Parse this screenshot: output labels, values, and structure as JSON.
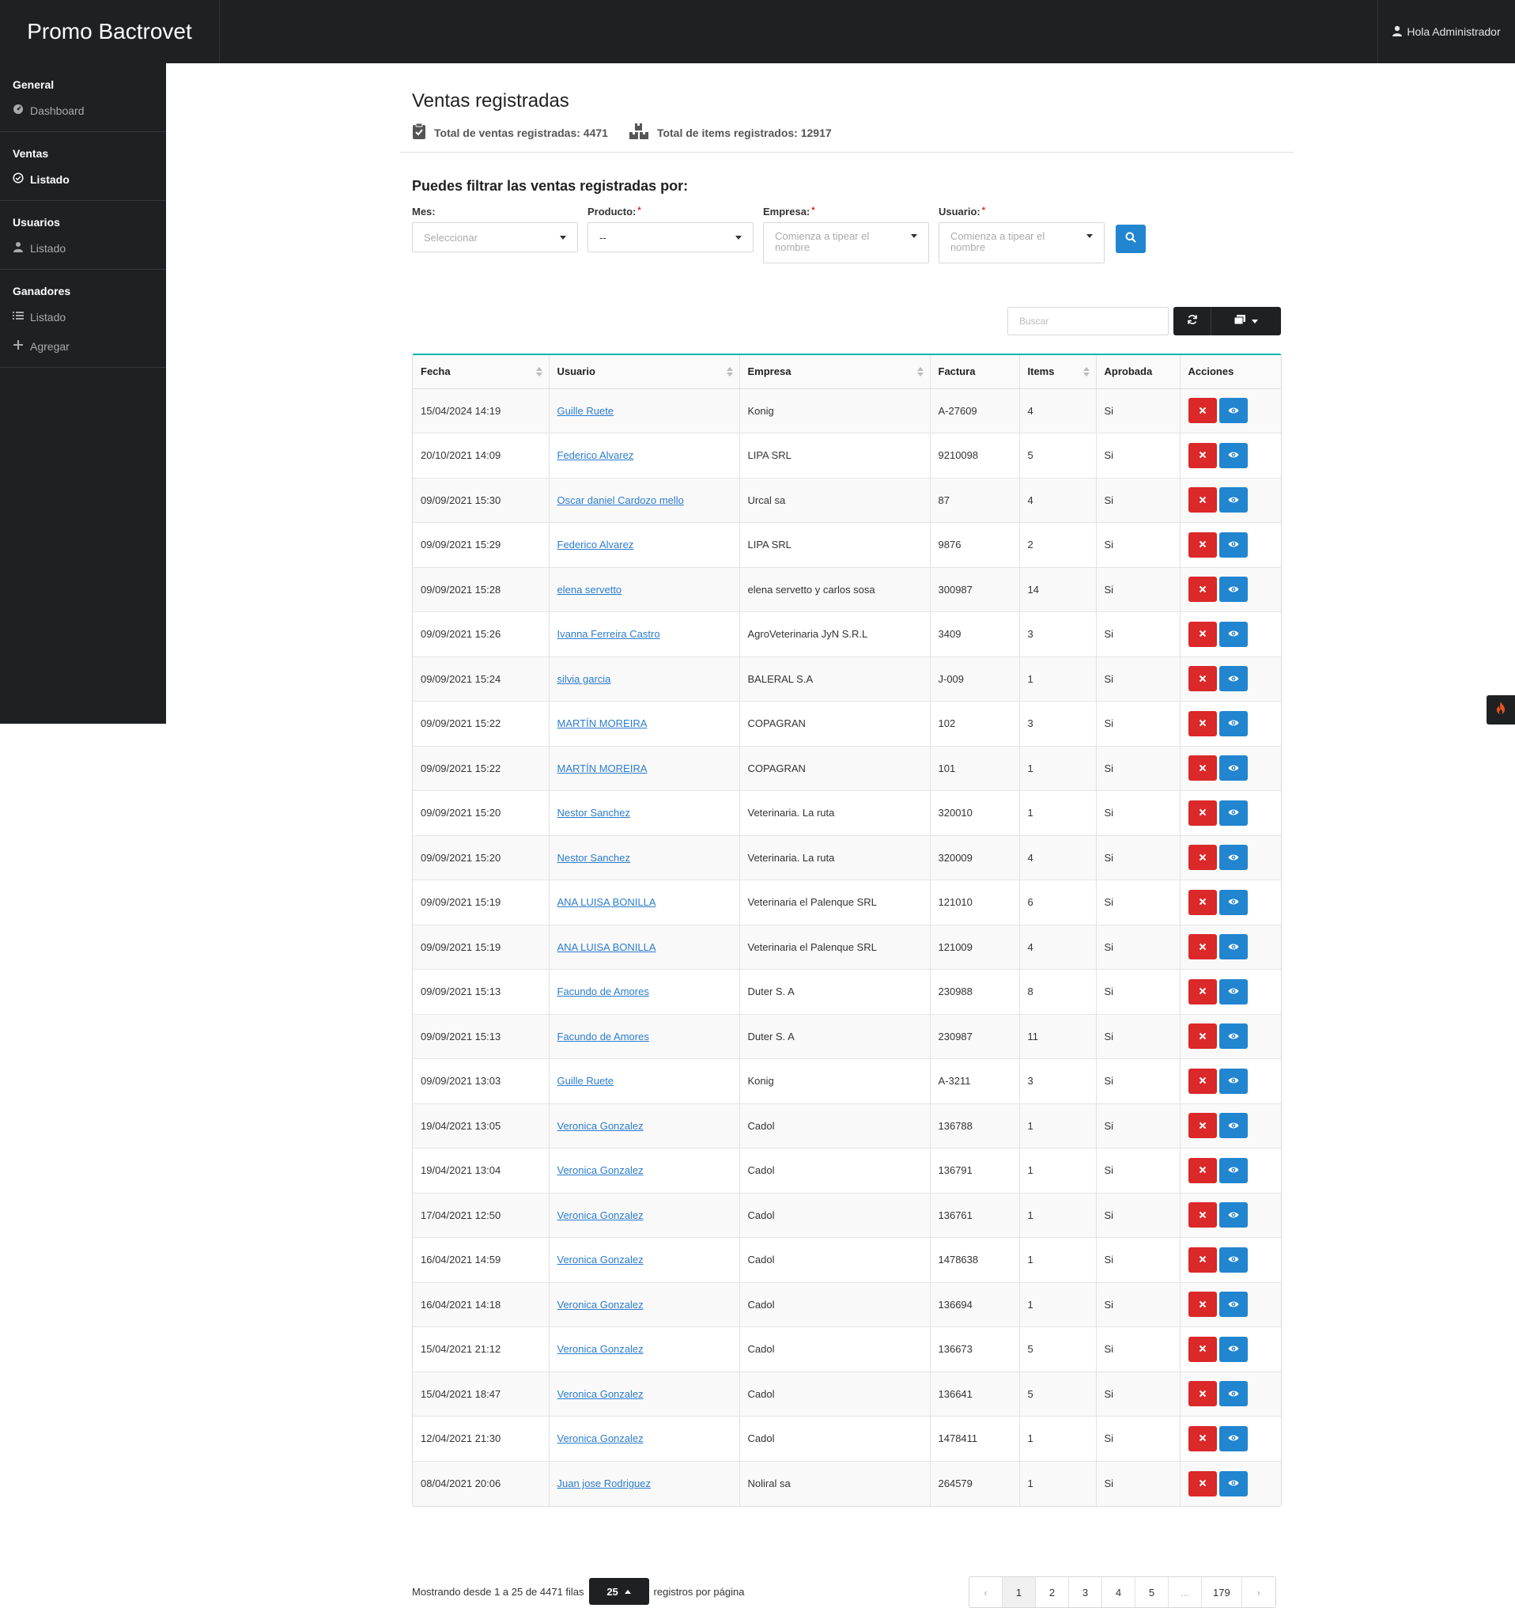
{
  "app": {
    "brand": "Promo Bactrovet",
    "user_greeting": "Hola Administrador"
  },
  "sidebar": {
    "sections": [
      {
        "title": "General",
        "items": [
          {
            "label": "Dashboard",
            "icon": "dashboard-icon"
          }
        ]
      },
      {
        "title": "Ventas",
        "items": [
          {
            "label": "Listado",
            "icon": "check-circle-icon",
            "active": true
          }
        ]
      },
      {
        "title": "Usuarios",
        "items": [
          {
            "label": "Listado",
            "icon": "user-icon"
          }
        ]
      },
      {
        "title": "Ganadores",
        "items": [
          {
            "label": "Listado",
            "icon": "list-icon"
          },
          {
            "label": "Agregar",
            "icon": "plus-icon"
          }
        ]
      }
    ]
  },
  "page": {
    "title": "Ventas registradas",
    "stats": {
      "total_ventas": "Total de ventas registradas: 4471",
      "total_items": "Total de items registrados: 12917"
    }
  },
  "filters": {
    "title": "Puedes filtrar las ventas registradas por:",
    "mes": {
      "label": "Mes:",
      "placeholder": "Seleccionar"
    },
    "producto": {
      "label": "Producto:",
      "value": "--"
    },
    "empresa": {
      "label": "Empresa:",
      "placeholder": "Comienza a tipear el nombre"
    },
    "usuario": {
      "label": "Usuario:",
      "placeholder": "Comienza a tipear el nombre"
    },
    "required_mark": "*"
  },
  "table": {
    "search_placeholder": "Buscar",
    "columns": [
      "Fecha",
      "Usuario",
      "Empresa",
      "Factura",
      "Items",
      "Aprobada",
      "Acciones"
    ],
    "rows": [
      {
        "fecha": "15/04/2024 14:19",
        "usuario": "Guille Ruete",
        "empresa": "Konig",
        "factura": "A-27609",
        "items": "4",
        "aprobada": "Si"
      },
      {
        "fecha": "20/10/2021 14:09",
        "usuario": "Federico Alvarez",
        "empresa": "LIPA SRL",
        "factura": "9210098",
        "items": "5",
        "aprobada": "Si"
      },
      {
        "fecha": "09/09/2021 15:30",
        "usuario": "Oscar daniel Cardozo mello",
        "empresa": "Urcal sa",
        "factura": "87",
        "items": "4",
        "aprobada": "Si"
      },
      {
        "fecha": "09/09/2021 15:29",
        "usuario": "Federico Alvarez",
        "empresa": "LIPA SRL",
        "factura": "9876",
        "items": "2",
        "aprobada": "Si"
      },
      {
        "fecha": "09/09/2021 15:28",
        "usuario": "elena servetto",
        "empresa": "elena servetto y carlos sosa",
        "factura": "300987",
        "items": "14",
        "aprobada": "Si"
      },
      {
        "fecha": "09/09/2021 15:26",
        "usuario": "Ivanna Ferreira Castro",
        "empresa": "AgroVeterinaria JyN S.R.L",
        "factura": "3409",
        "items": "3",
        "aprobada": "Si"
      },
      {
        "fecha": "09/09/2021 15:24",
        "usuario": "silvia garcia",
        "empresa": "BALERAL S.A",
        "factura": "J-009",
        "items": "1",
        "aprobada": "Si"
      },
      {
        "fecha": "09/09/2021 15:22",
        "usuario": "MARTÍN MOREIRA",
        "empresa": "COPAGRAN",
        "factura": "102",
        "items": "3",
        "aprobada": "Si"
      },
      {
        "fecha": "09/09/2021 15:22",
        "usuario": "MARTÍN MOREIRA",
        "empresa": "COPAGRAN",
        "factura": "101",
        "items": "1",
        "aprobada": "Si"
      },
      {
        "fecha": "09/09/2021 15:20",
        "usuario": "Nestor Sanchez",
        "empresa": "Veterinaria. La ruta",
        "factura": "320010",
        "items": "1",
        "aprobada": "Si"
      },
      {
        "fecha": "09/09/2021 15:20",
        "usuario": "Nestor Sanchez",
        "empresa": "Veterinaria. La ruta",
        "factura": "320009",
        "items": "4",
        "aprobada": "Si"
      },
      {
        "fecha": "09/09/2021 15:19",
        "usuario": "ANA LUISA BONILLA",
        "empresa": "Veterinaria el Palenque SRL",
        "factura": "121010",
        "items": "6",
        "aprobada": "Si"
      },
      {
        "fecha": "09/09/2021 15:19",
        "usuario": "ANA LUISA BONILLA",
        "empresa": "Veterinaria el Palenque SRL",
        "factura": "121009",
        "items": "4",
        "aprobada": "Si"
      },
      {
        "fecha": "09/09/2021 15:13",
        "usuario": "Facundo de Amores",
        "empresa": "Duter S. A",
        "factura": "230988",
        "items": "8",
        "aprobada": "Si"
      },
      {
        "fecha": "09/09/2021 15:13",
        "usuario": "Facundo de Amores",
        "empresa": "Duter S. A",
        "factura": "230987",
        "items": "11",
        "aprobada": "Si"
      },
      {
        "fecha": "09/09/2021 13:03",
        "usuario": "Guille Ruete",
        "empresa": "Konig",
        "factura": "A-3211",
        "items": "3",
        "aprobada": "Si"
      },
      {
        "fecha": "19/04/2021 13:05",
        "usuario": "Veronica Gonzalez",
        "empresa": "Cadol",
        "factura": "136788",
        "items": "1",
        "aprobada": "Si"
      },
      {
        "fecha": "19/04/2021 13:04",
        "usuario": "Veronica Gonzalez",
        "empresa": "Cadol",
        "factura": "136791",
        "items": "1",
        "aprobada": "Si"
      },
      {
        "fecha": "17/04/2021 12:50",
        "usuario": "Veronica Gonzalez",
        "empresa": "Cadol",
        "factura": "136761",
        "items": "1",
        "aprobada": "Si"
      },
      {
        "fecha": "16/04/2021 14:59",
        "usuario": "Veronica Gonzalez",
        "empresa": "Cadol",
        "factura": "1478638",
        "items": "1",
        "aprobada": "Si"
      },
      {
        "fecha": "16/04/2021 14:18",
        "usuario": "Veronica Gonzalez",
        "empresa": "Cadol",
        "factura": "136694",
        "items": "1",
        "aprobada": "Si"
      },
      {
        "fecha": "15/04/2021 21:12",
        "usuario": "Veronica Gonzalez",
        "empresa": "Cadol",
        "factura": "136673",
        "items": "5",
        "aprobada": "Si"
      },
      {
        "fecha": "15/04/2021 18:47",
        "usuario": "Veronica Gonzalez",
        "empresa": "Cadol",
        "factura": "136641",
        "items": "5",
        "aprobada": "Si"
      },
      {
        "fecha": "12/04/2021 21:30",
        "usuario": "Veronica Gonzalez",
        "empresa": "Cadol",
        "factura": "1478411",
        "items": "1",
        "aprobada": "Si"
      },
      {
        "fecha": "08/04/2021 20:06",
        "usuario": "Juan jose Rodriguez",
        "empresa": "Noliral sa",
        "factura": "264579",
        "items": "1",
        "aprobada": "Si"
      }
    ]
  },
  "footer": {
    "showing": "Mostrando desde 1 a 25 de 4471 filas",
    "per_page_value": "25",
    "per_page_suffix": "registros por página",
    "pages": [
      "‹",
      "1",
      "2",
      "3",
      "4",
      "5",
      "...",
      "179",
      "›"
    ],
    "active_page": "1"
  },
  "colors": {
    "dark": "#1f2022",
    "primary": "#2185d0",
    "danger": "#db2828",
    "accent": "#00b5ad",
    "fire": "#e8541e"
  }
}
